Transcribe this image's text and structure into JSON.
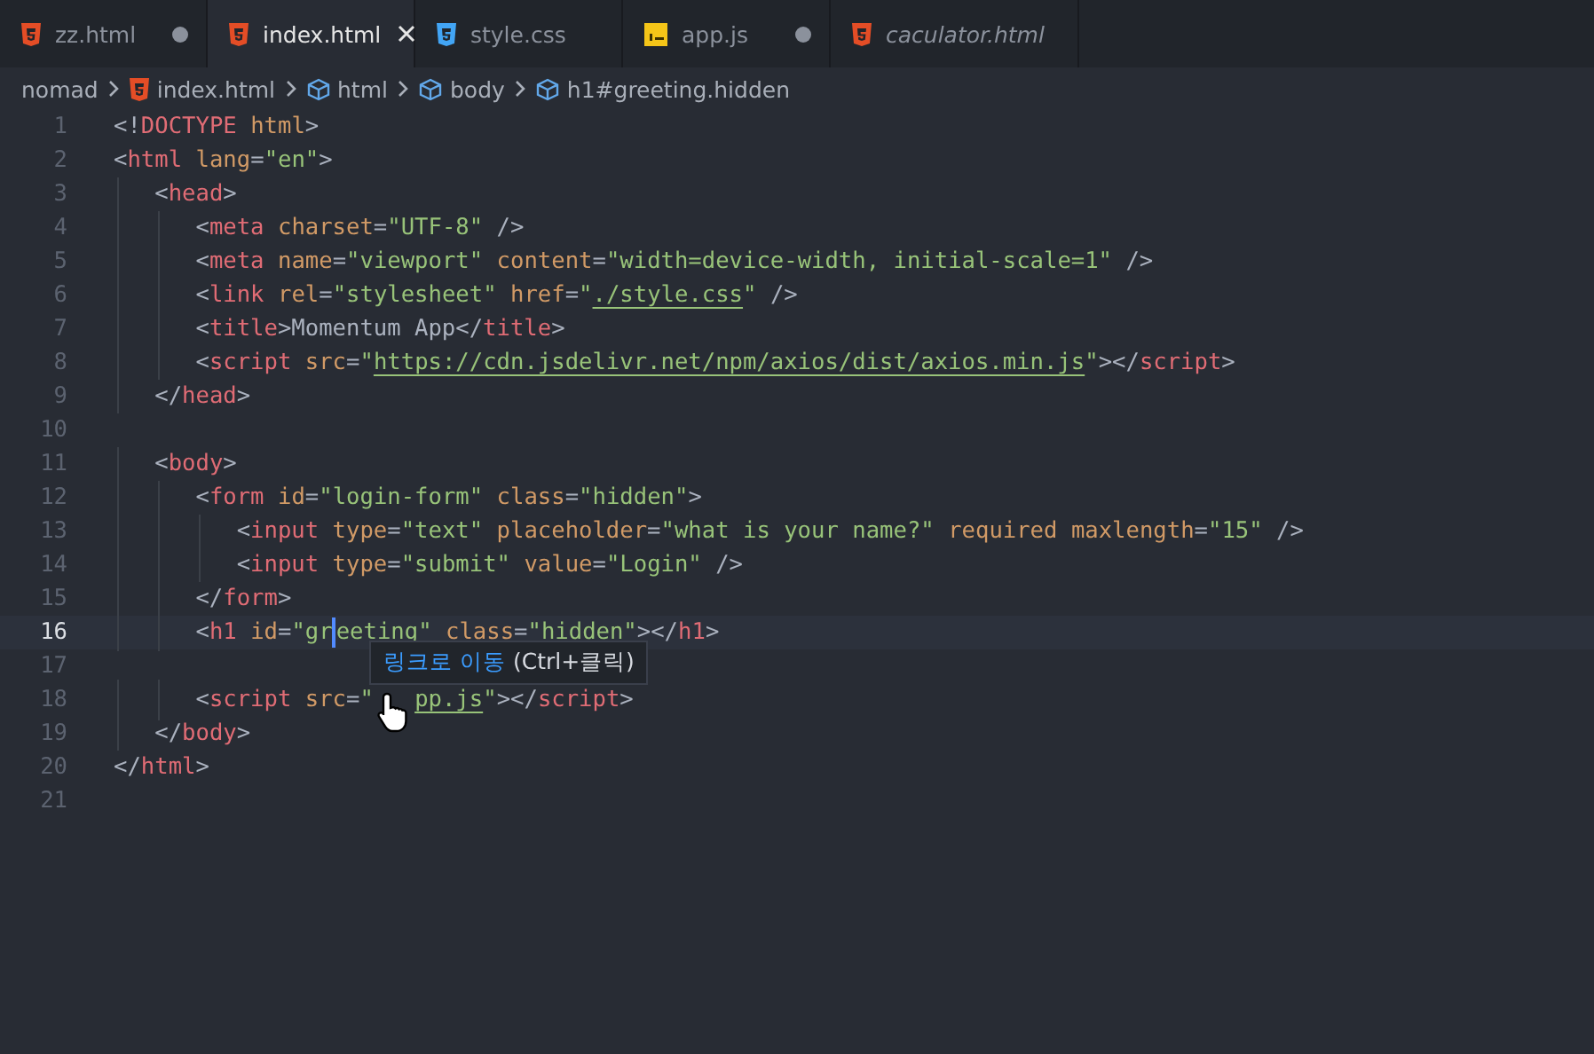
{
  "tabs": [
    {
      "label": "zz.html",
      "kind": "html",
      "selected": false,
      "modified": true,
      "preview": false
    },
    {
      "label": "index.html",
      "kind": "html",
      "selected": true,
      "modified": false,
      "preview": false
    },
    {
      "label": "style.css",
      "kind": "css",
      "selected": false,
      "modified": false,
      "preview": false
    },
    {
      "label": "app.js",
      "kind": "js",
      "selected": false,
      "modified": true,
      "preview": false
    },
    {
      "label": "caculator.html",
      "kind": "html",
      "selected": false,
      "modified": false,
      "preview": true
    }
  ],
  "breadcrumb": [
    {
      "label": "nomad",
      "kind": "folder"
    },
    {
      "label": "index.html",
      "kind": "html"
    },
    {
      "label": "html",
      "kind": "element"
    },
    {
      "label": "body",
      "kind": "element"
    },
    {
      "label": "h1#greeting.hidden",
      "kind": "element"
    }
  ],
  "lines": [
    {
      "num": "1",
      "current": false,
      "segments": [
        {
          "kind": "code",
          "text": "<!DOCTYPE html>"
        }
      ]
    },
    {
      "num": "2",
      "current": false,
      "segments": [
        {
          "kind": "code",
          "text": "<html lang=\"en\">"
        }
      ]
    },
    {
      "num": "3",
      "current": false,
      "segments": [
        {
          "kind": "code",
          "text": "   <head>"
        }
      ]
    },
    {
      "num": "4",
      "current": false,
      "segments": [
        {
          "kind": "code",
          "text": "      <meta charset=\"UTF-8\" />"
        }
      ]
    },
    {
      "num": "5",
      "current": false,
      "segments": [
        {
          "kind": "code",
          "text": "      <meta name=\"viewport\" content=\"width=device-width, initial-scale=1\" />"
        }
      ]
    },
    {
      "num": "6",
      "current": false,
      "segments": [
        {
          "kind": "code",
          "text": "      <link rel=\"stylesheet\" href=\"./style.css\" />"
        }
      ]
    },
    {
      "num": "7",
      "current": false,
      "segments": [
        {
          "kind": "code",
          "text": "      <title>Momentum App</title>"
        }
      ]
    },
    {
      "num": "8",
      "current": false,
      "segments": [
        {
          "kind": "code",
          "text": "      <script src=\"https://cdn.jsdelivr.net/npm/axios/dist/axios.min.js\"></script>"
        }
      ]
    },
    {
      "num": "9",
      "current": false,
      "segments": [
        {
          "kind": "code",
          "text": "   </head>"
        }
      ]
    },
    {
      "num": "10",
      "current": false
    },
    {
      "num": "11",
      "current": false,
      "segments": [
        {
          "kind": "code",
          "text": "   <body>"
        }
      ]
    },
    {
      "num": "12",
      "current": false,
      "segments": [
        {
          "kind": "code",
          "text": "      <form id=\"login-form\" class=\"hidden\">"
        }
      ]
    },
    {
      "num": "13",
      "current": false,
      "segments": [
        {
          "kind": "code",
          "text": "         <input type=\"text\" placeholder=\"what is your name?\" required maxlength=\"15\" />"
        }
      ]
    },
    {
      "num": "14",
      "current": false,
      "segments": [
        {
          "kind": "code",
          "text": "         <input type=\"submit\" value=\"Login\" />"
        }
      ]
    },
    {
      "num": "15",
      "current": false,
      "segments": [
        {
          "kind": "code",
          "text": "      </form>"
        }
      ]
    },
    {
      "num": "16",
      "current": true,
      "segments": [
        {
          "kind": "code",
          "text": "      <h1 id=\"gr"
        },
        {
          "kind": "caret"
        },
        {
          "kind": "code",
          "text": "eeting\" class=\"hidden\"></h1>"
        }
      ]
    },
    {
      "num": "17",
      "current": false
    },
    {
      "num": "18",
      "current": false,
      "segments": [
        {
          "kind": "code",
          "text": "      <script src=\""
        },
        {
          "kind": "pointer"
        },
        {
          "kind": "code",
          "text": "pp.js\"></script>"
        }
      ]
    },
    {
      "num": "19",
      "current": false,
      "segments": [
        {
          "kind": "code",
          "text": "   </body>"
        }
      ]
    },
    {
      "num": "20",
      "current": false,
      "segments": [
        {
          "kind": "code",
          "text": "</html>"
        }
      ]
    },
    {
      "num": "21",
      "current": false
    }
  ],
  "tooltip": {
    "action": "링크로 이동",
    "shortcut": "(Ctrl+클릭)"
  }
}
